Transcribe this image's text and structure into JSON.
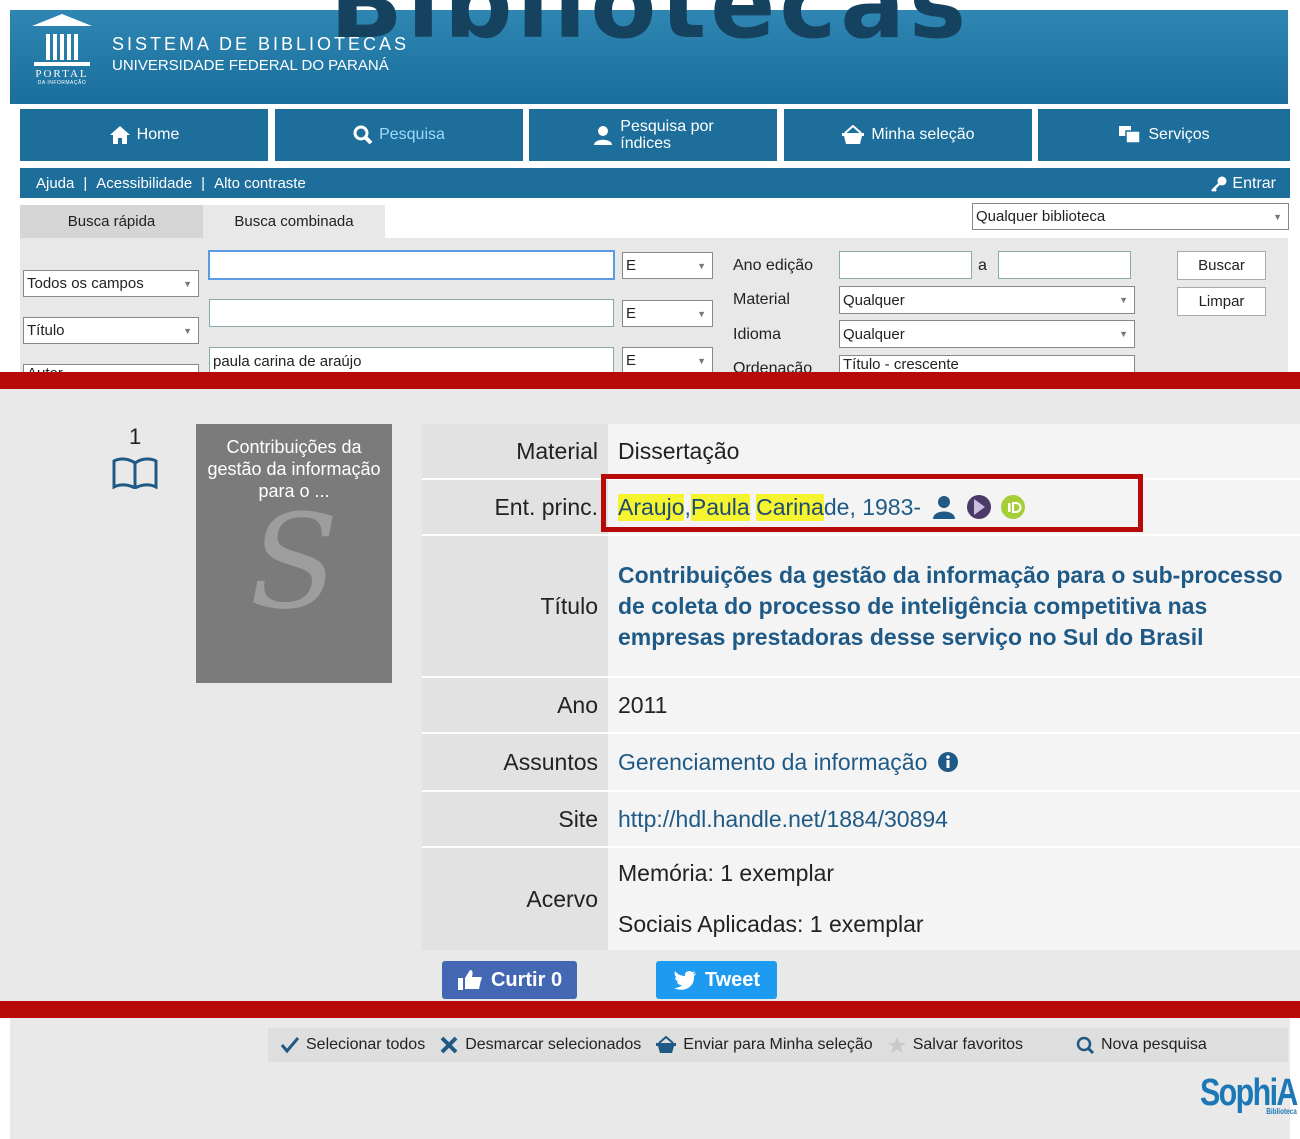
{
  "header": {
    "big_title": "Bibliotecas",
    "logo_text": "PORTAL",
    "logo_subtext": "DA INFORMAÇÃO",
    "system_name": "SISTEMA DE BIBLIOTECAS",
    "university": "UNIVERSIDADE FEDERAL DO PARANÁ"
  },
  "nav": {
    "home": "Home",
    "search": "Pesquisa",
    "index_line1": "Pesquisa por",
    "index_line2": "índices",
    "selection": "Minha seleção",
    "services": "Serviços"
  },
  "helpbar": {
    "help": "Ajuda",
    "accessibility": "Acessibilidade",
    "contrast": "Alto contraste",
    "login": "Entrar"
  },
  "search": {
    "tab_quick": "Busca rápida",
    "tab_combined": "Busca combinada",
    "library": "Qualquer biblioteca",
    "field1": "Todos os campos",
    "field2": "Título",
    "field3": "Autor",
    "value1": "",
    "value2": "",
    "value3": "paula carina de araújo",
    "op": "E",
    "year_label": "Ano edição",
    "year_to": "a",
    "material_label": "Material",
    "material_value": "Qualquer",
    "language_label": "Idioma",
    "language_value": "Qualquer",
    "order_label": "Ordenação",
    "order_value": "Título - crescente",
    "search_btn": "Buscar",
    "clear_btn": "Limpar"
  },
  "result": {
    "number": "1",
    "cover_text": "Contribuições da gestão da informação para o ...",
    "cover_letter": "S",
    "material_label": "Material",
    "material": "Dissertação",
    "author_label": "Ent. princ.",
    "author_hl1": "Araujo",
    "author_sep": ", ",
    "author_hl2": "Paula",
    "author_hl3": "Carina",
    "author_rest": " de, 1983-",
    "title_label": "Título",
    "title": "Contribuições da gestão da informação para o sub-processo de coleta do processo de inteligência competitiva nas empresas prestadoras desse serviço no Sul do Brasil",
    "year_label": "Ano",
    "year": "2011",
    "subjects_label": "Assuntos",
    "subject": "Gerenciamento da informação",
    "site_label": "Site",
    "site": "http://hdl.handle.net/1884/30894",
    "holdings_label": "Acervo",
    "holding1": "Memória: 1 exemplar",
    "holding2": "Sociais Aplicadas: 1 exemplar",
    "like": "Curtir 0",
    "tweet": "Tweet"
  },
  "toolbar": {
    "select_all": "Selecionar todos",
    "deselect": "Desmarcar selecionados",
    "send": "Enviar para Minha seleção",
    "save": "Salvar favoritos",
    "new_search": "Nova pesquisa"
  },
  "brand": {
    "name": "SophiA",
    "sub": "Biblioteca"
  },
  "colors": {
    "primary": "#1d6e9b",
    "highlight": "#f6f32f",
    "red_frame": "#b90a0a",
    "link": "#1f5a86"
  }
}
